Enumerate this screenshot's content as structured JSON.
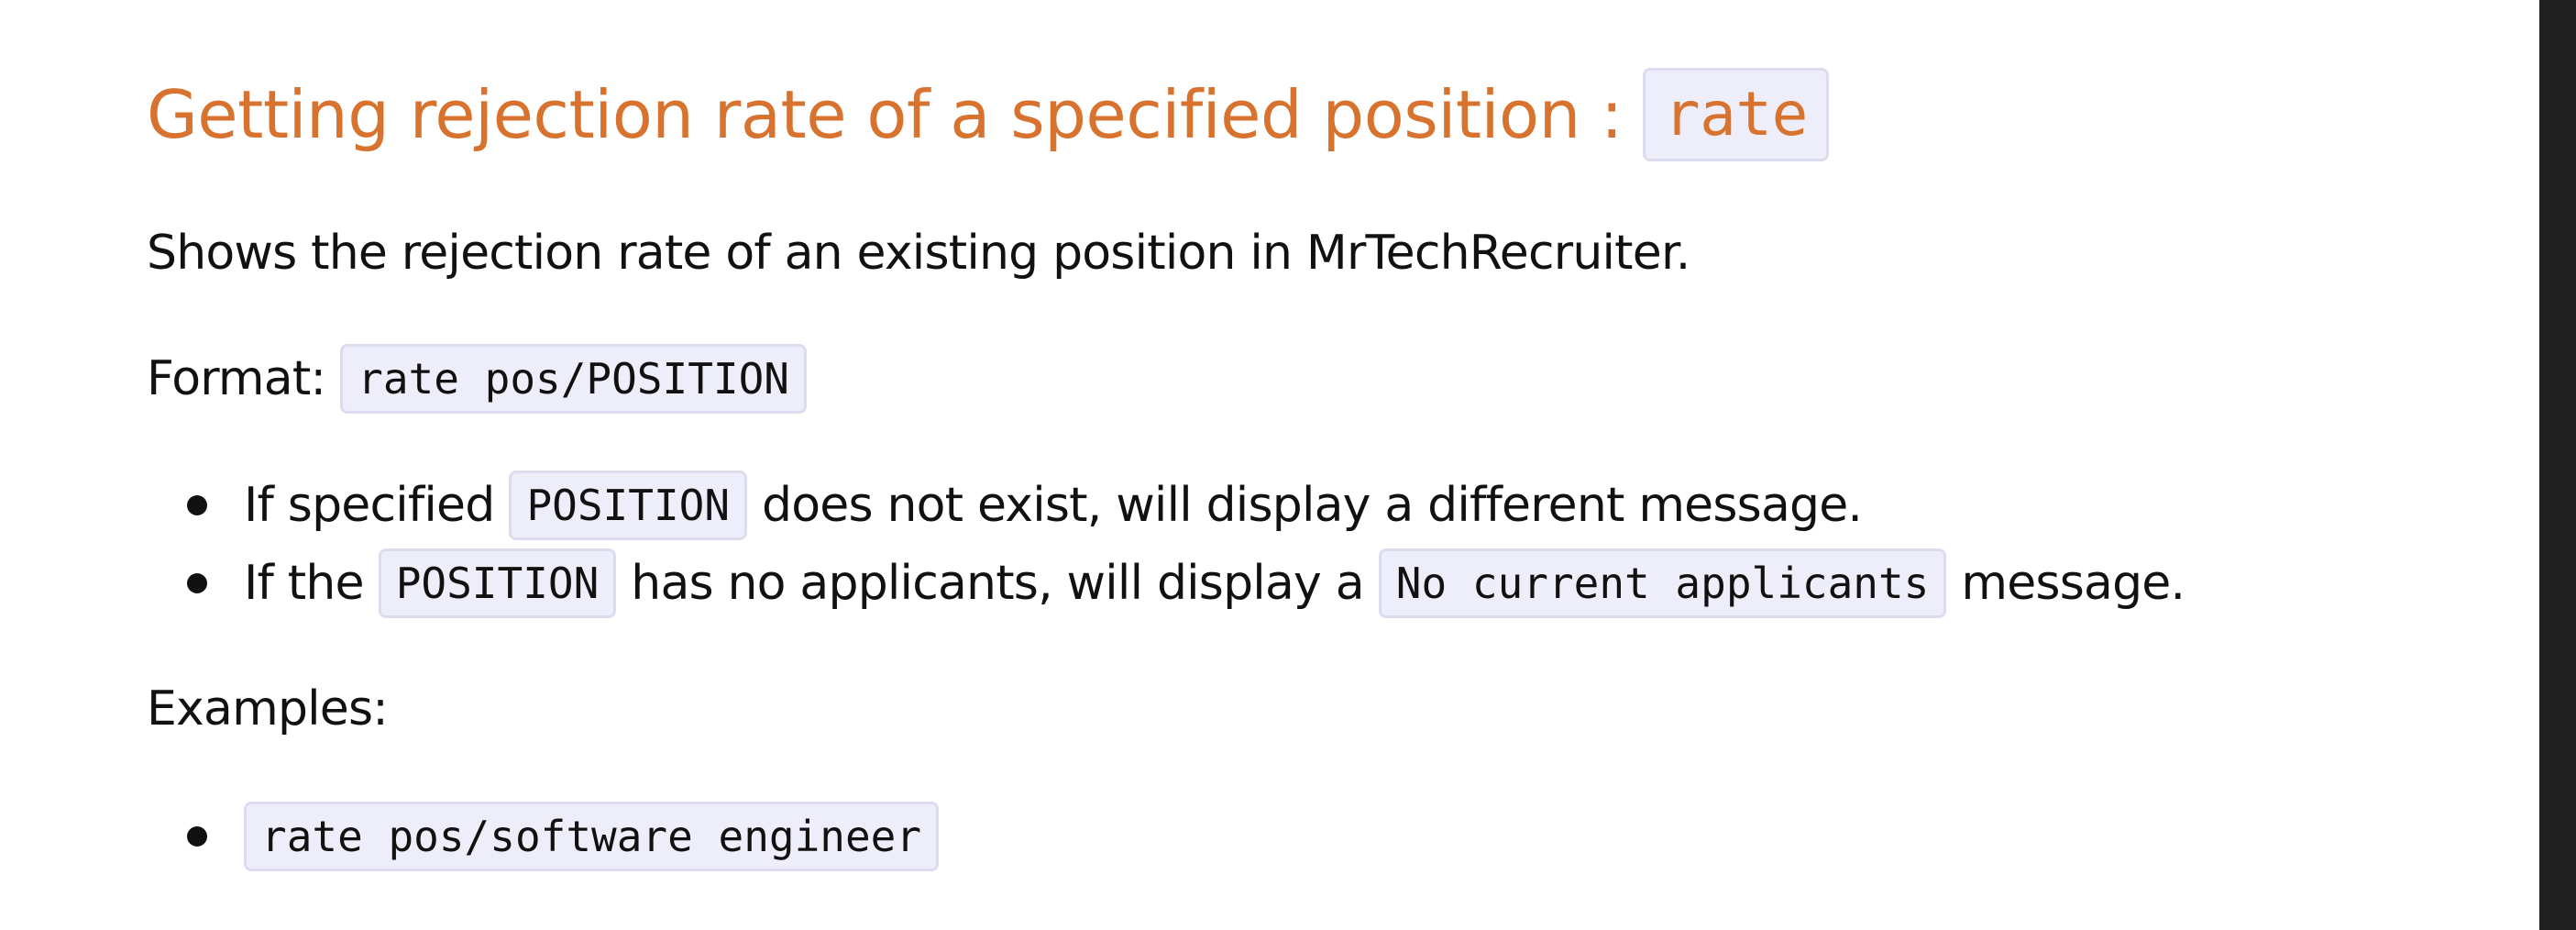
{
  "heading": {
    "text": "Getting rejection rate of a specified position :",
    "command": "rate"
  },
  "description": "Shows the rejection rate of an existing position in MrTechRecruiter.",
  "format": {
    "label": "Format:",
    "code": "rate pos/POSITION"
  },
  "notes": [
    {
      "before": "If specified",
      "code": "POSITION",
      "after": "does not exist, will display a different message."
    },
    {
      "before": "If the",
      "code": "POSITION",
      "middle": "has no applicants, will display a",
      "code2": "No current applicants",
      "after": "message."
    }
  ],
  "examples": {
    "label": "Examples:",
    "items": [
      "rate pos/software engineer"
    ]
  }
}
